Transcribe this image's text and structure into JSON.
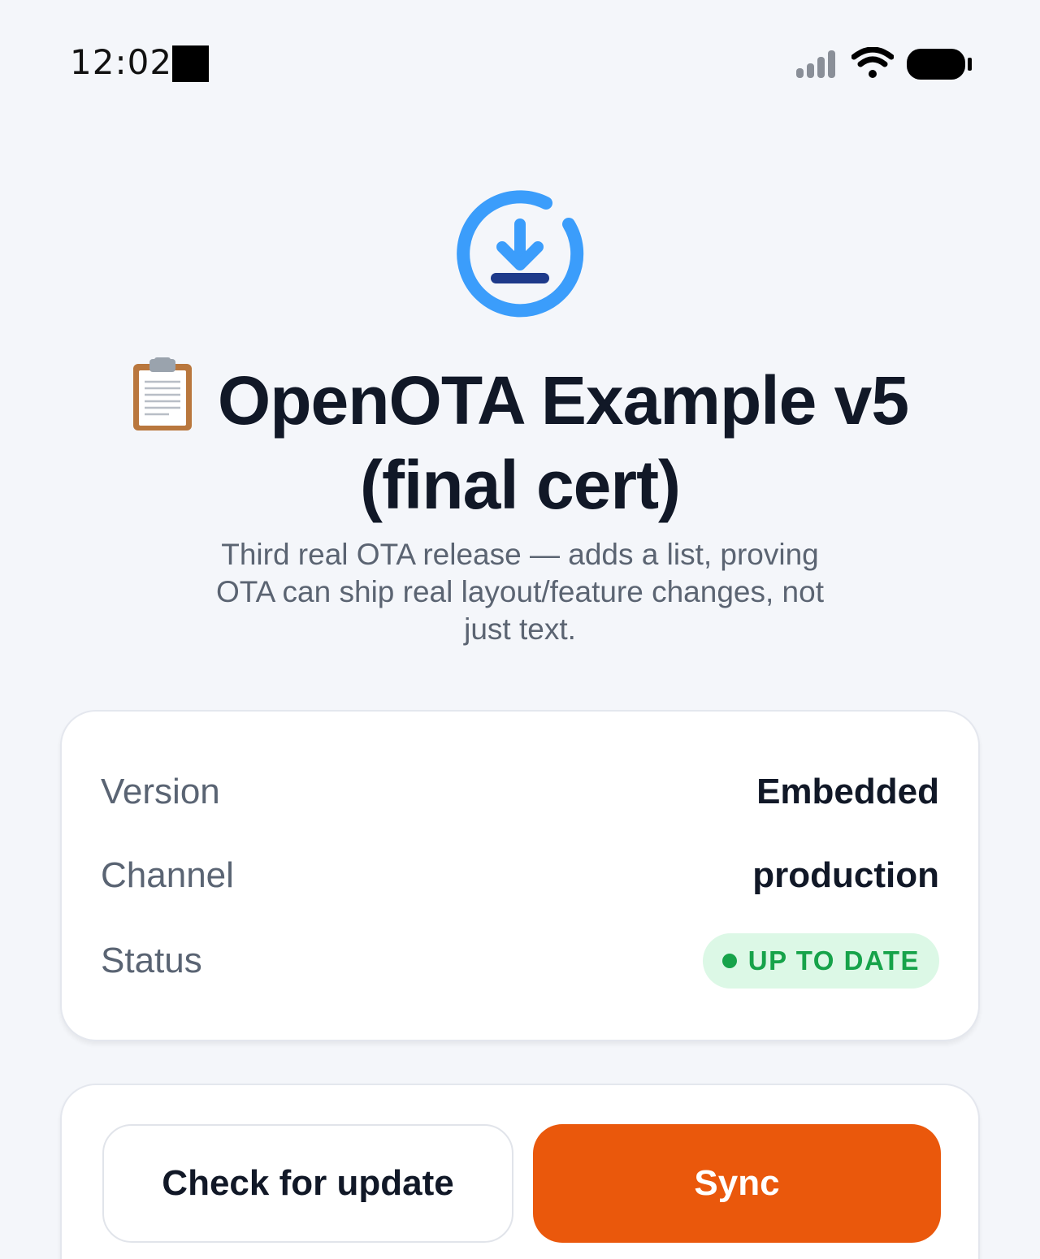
{
  "status_bar": {
    "time": "12:02",
    "icons": [
      "signal-icon",
      "wifi-icon",
      "battery-icon"
    ]
  },
  "hero": {
    "icon": "download-sync-icon",
    "title_emoji": "clipboard-icon",
    "title": "OpenOTA Example v5 (final cert)",
    "subtitle": "Third real OTA release — adds a list, proving OTA can ship real layout/feature changes, not just text."
  },
  "info": {
    "rows": [
      {
        "label": "Version",
        "value": "Embedded"
      },
      {
        "label": "Channel",
        "value": "production"
      },
      {
        "label": "Status",
        "value": "UP TO DATE"
      }
    ]
  },
  "actions": {
    "check_label": "Check for update",
    "sync_label": "Sync"
  },
  "colors": {
    "background": "#f4f6fa",
    "accent_blue": "#3b9dfb",
    "accent_dark": "#1e3a8a",
    "sync_orange": "#ea580c",
    "status_green": "#16a34a",
    "status_green_bg": "#dcf8e6",
    "title": "#111827",
    "muted": "#5b6472"
  }
}
